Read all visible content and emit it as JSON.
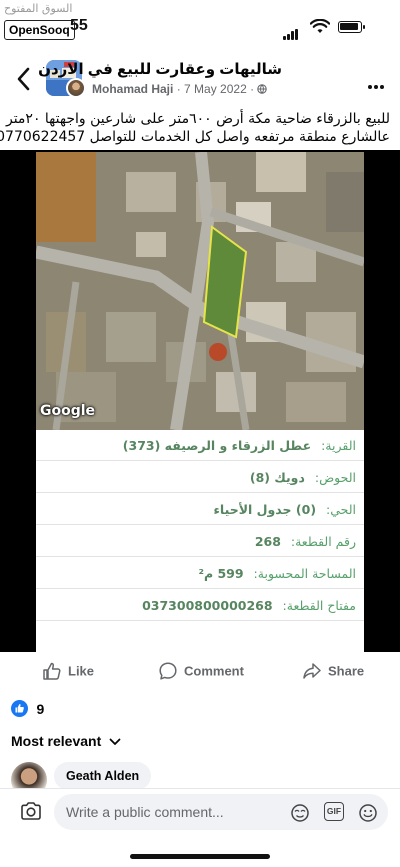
{
  "status": {
    "time": "55",
    "watermark": "السوق المفتوح",
    "carrier_badge": "OpenSooq"
  },
  "header": {
    "back_icon": "chevron-left-icon",
    "group_name": "شاليهات وعقارت للبيع  في الاردن",
    "author": "Mohamad Haji",
    "date": "7 May 2022",
    "separator": "·",
    "privacy_icon": "globe-icon",
    "more_icon": "more-horizontal-icon"
  },
  "post": {
    "line1": "للبيع بالزرقاء ضاحية مكة أرض ٦٠٠متر على شارعين واجهتها ٢٠متر",
    "line2": "عالشارع منطقة مرتفعه  واصل كل الخدمات   للتواصل 0770622457"
  },
  "map": {
    "attribution": "Google"
  },
  "parcel_info": [
    {
      "label": "القرية:",
      "value": "عطل الزرقاء و الرصيفه (373)"
    },
    {
      "label": "الحوض:",
      "value": "دويك (8)"
    },
    {
      "label": "الحي:",
      "value": "(0) جدول الأحياء"
    },
    {
      "label": "رقم القطعة:",
      "value": "268"
    },
    {
      "label": "المساحة المحسوبة:",
      "value": "599 م²"
    },
    {
      "label": "مفتاح القطعة:",
      "value": "037300800000268"
    }
  ],
  "actions": {
    "like": "Like",
    "comment": "Comment",
    "share": "Share"
  },
  "reactions": {
    "count": "9",
    "icon": "like-icon"
  },
  "comments": {
    "sort_label": "Most relevant",
    "first_commenter": "Geath Alden"
  },
  "composer": {
    "placeholder": "Write a public comment...",
    "gif_label": "GIF"
  },
  "colors": {
    "facebook_blue": "#1877f2",
    "parcel_green": "#57a06b",
    "text_gray": "#65676b"
  }
}
